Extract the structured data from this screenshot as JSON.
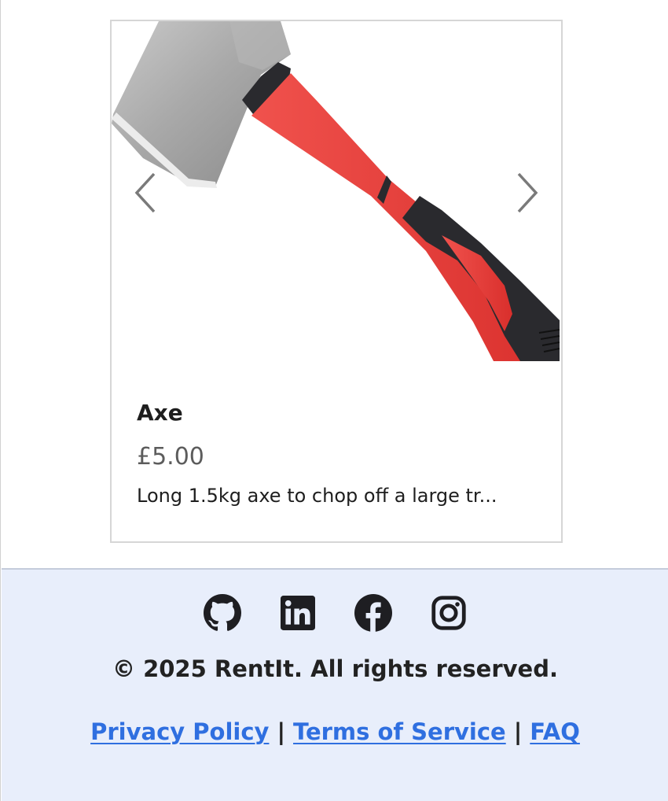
{
  "product": {
    "name": "Axe",
    "price": "£5.00",
    "description": "Long 1.5kg axe to chop off a large tr...",
    "image_icon": "axe-image",
    "prev_icon": "chevron-left-icon",
    "next_icon": "chevron-right-icon"
  },
  "footer": {
    "social": [
      {
        "icon": "github-icon"
      },
      {
        "icon": "linkedin-icon"
      },
      {
        "icon": "facebook-icon"
      },
      {
        "icon": "instagram-icon"
      }
    ],
    "copyright": "© 2025 RentIt. All rights reserved.",
    "links": {
      "privacy": "Privacy Policy",
      "terms": "Terms of Service",
      "faq": "FAQ",
      "separator": "|"
    }
  },
  "colors": {
    "link": "#2f6fe0",
    "footer_bg": "#e8eefb",
    "price": "#5c5c5c",
    "handle_red": "#e23a36",
    "handle_black": "#2a2a2e"
  }
}
